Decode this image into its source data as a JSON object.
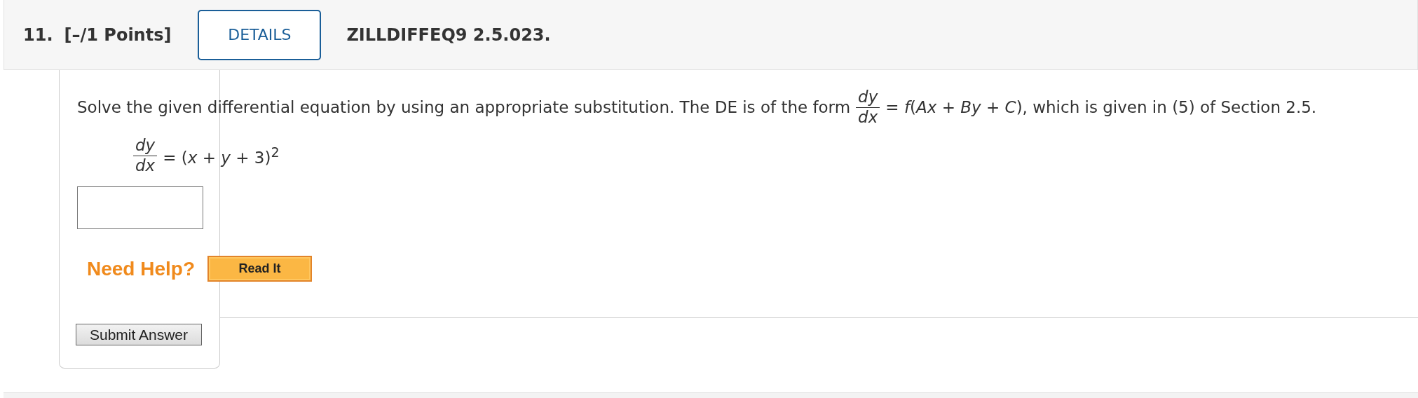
{
  "header": {
    "number": "11.",
    "points": "[–/1 Points]",
    "details_button": "DETAILS",
    "problem_id": "ZILLDIFFEQ9 2.5.023."
  },
  "question": {
    "before": "Solve the given differential equation by using an appropriate substitution. The DE is of the form",
    "fraction": {
      "numerator": "dy",
      "denominator": "dx"
    },
    "after": "= *f*(*Ax* + *By* + *C*), which is given in (5) of Section 2.5."
  },
  "equation": {
    "fraction": {
      "numerator": "dy",
      "denominator": "dx"
    },
    "rhs": "= (*x* + *y* + 3)$^{2}$"
  },
  "help": {
    "label": "Need Help?",
    "buttons": [
      "Read It"
    ]
  },
  "submit_button": "Submit Answer"
}
